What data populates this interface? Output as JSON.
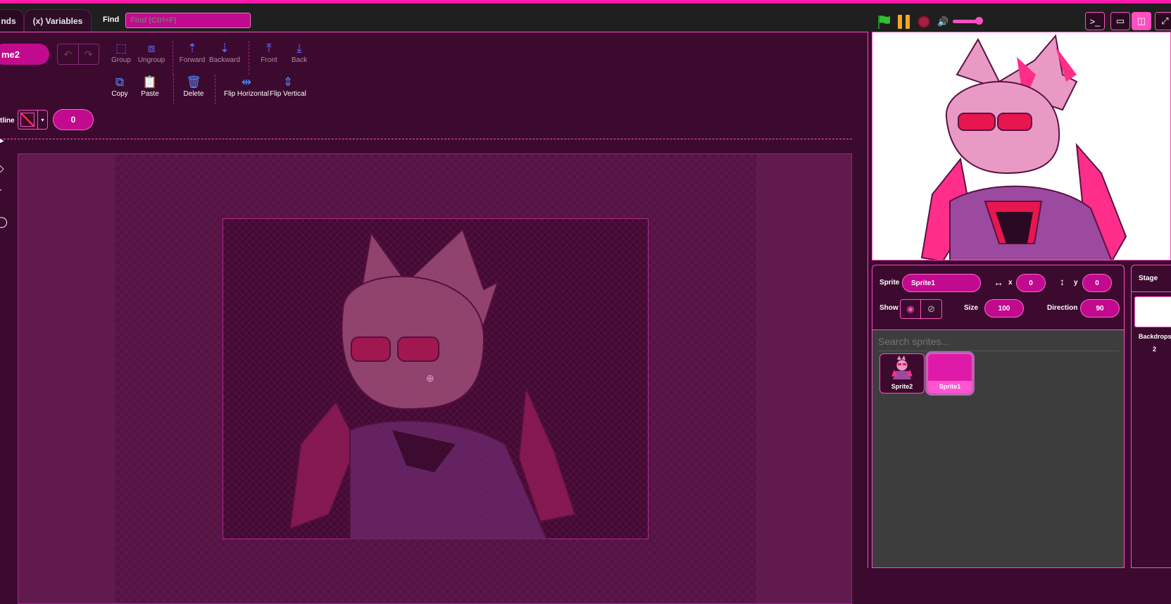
{
  "menubar": {
    "tabs": [
      {
        "label": "nds"
      },
      {
        "label": "(x) Variables"
      }
    ],
    "find_label": "Find",
    "find_placeholder": "Find (Ctrl+F)"
  },
  "paint": {
    "costume_name": "me2",
    "toolbar_row1": [
      {
        "label": "Group",
        "icon": "group-icon"
      },
      {
        "label": "Ungroup",
        "icon": "ungroup-icon"
      },
      {
        "label": "Forward",
        "icon": "forward-icon"
      },
      {
        "label": "Backward",
        "icon": "backward-icon"
      },
      {
        "label": "Front",
        "icon": "front-icon"
      },
      {
        "label": "Back",
        "icon": "back-icon"
      }
    ],
    "toolbar_row2": [
      {
        "label": "Copy",
        "icon": "copy-icon"
      },
      {
        "label": "Paste",
        "icon": "paste-icon"
      },
      {
        "label": "Delete",
        "icon": "delete-icon"
      },
      {
        "label": "Flip Horizontal",
        "icon": "flip-horizontal-icon"
      },
      {
        "label": "Flip Vertical",
        "icon": "flip-vertical-icon"
      }
    ],
    "outline_label": "tline",
    "outline_width": "0"
  },
  "sprite_info": {
    "sprite_label": "Sprite",
    "sprite_name": "Sprite1",
    "x_label": "x",
    "x_value": "0",
    "y_label": "y",
    "y_value": "0",
    "show_label": "Show",
    "size_label": "Size",
    "size_value": "100",
    "direction_label": "Direction",
    "direction_value": "90"
  },
  "sprite_list": {
    "search_placeholder": "Search sprites...",
    "sprites": [
      {
        "name": "Sprite2",
        "selected": false
      },
      {
        "name": "Sprite1",
        "selected": true
      }
    ]
  },
  "stage_panel": {
    "title": "Stage",
    "backdrops_label": "Backdrops",
    "backdrops_count": "2"
  },
  "colors": {
    "accent": "#ff4fc0",
    "background": "#3c0a2f",
    "input": "#c20a8e"
  }
}
